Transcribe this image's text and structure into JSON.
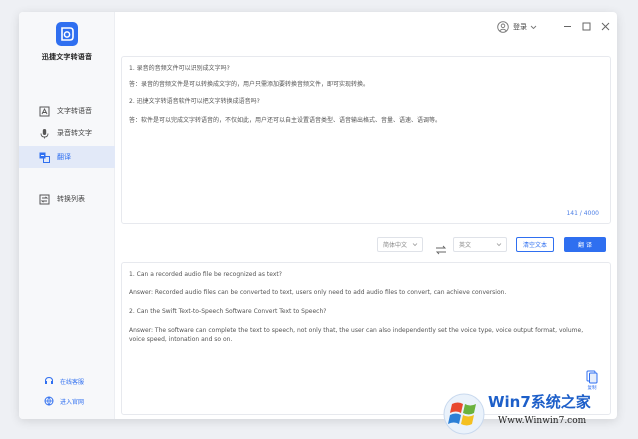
{
  "app": {
    "name": "迅捷文字转语音",
    "brand_color": "#2f6ff0"
  },
  "sidebar": {
    "items": [
      {
        "label": "文字转语音",
        "icon": "text-to-speech-icon"
      },
      {
        "label": "录音转文字",
        "icon": "microphone-icon"
      },
      {
        "label": "翻译",
        "icon": "translate-icon",
        "active": true
      },
      {
        "label": "转换列表",
        "icon": "convert-list-icon"
      }
    ],
    "footer": [
      {
        "label": "在线客服",
        "icon": "customer-service-icon"
      },
      {
        "label": "进入官网",
        "icon": "website-icon"
      }
    ]
  },
  "titlebar": {
    "login_label": "登录"
  },
  "source": {
    "lines": [
      "1. 录音的音频文件可以识别成文字吗?",
      "答：录音的音频文件是可以转换成文字的，用户只需添加要转换音频文件，即可实现转换。",
      "2. 迅捷文字转语音软件可以把文字转换成语音吗?",
      "答：软件是可以完成文字转语音的，不仅如此，用户还可以自主设置语音类型、语音输出格式、音量、语速、语调等。"
    ],
    "counter": "141 / 4000"
  },
  "toolbar": {
    "source_lang": "简体中文",
    "target_lang": "英文",
    "clear_label": "清空文本",
    "translate_label": "翻 译"
  },
  "output": {
    "lines": [
      "1. Can a recorded audio file be recognized as text?",
      "Answer: Recorded audio files can be converted to text, users only need to add audio files to convert, can achieve conversion.",
      "2. Can the Swift Text-to-Speech Software Convert Text to Speech?",
      "Answer: The software can complete the text to speech, not only that, the user can also independently set the voice type, voice output format, volume,",
      "voice speed, intonation and so on."
    ],
    "copy_label": "复制"
  },
  "watermark": {
    "title": "Win7系统之家",
    "url": "Www.Winwin7.com"
  }
}
